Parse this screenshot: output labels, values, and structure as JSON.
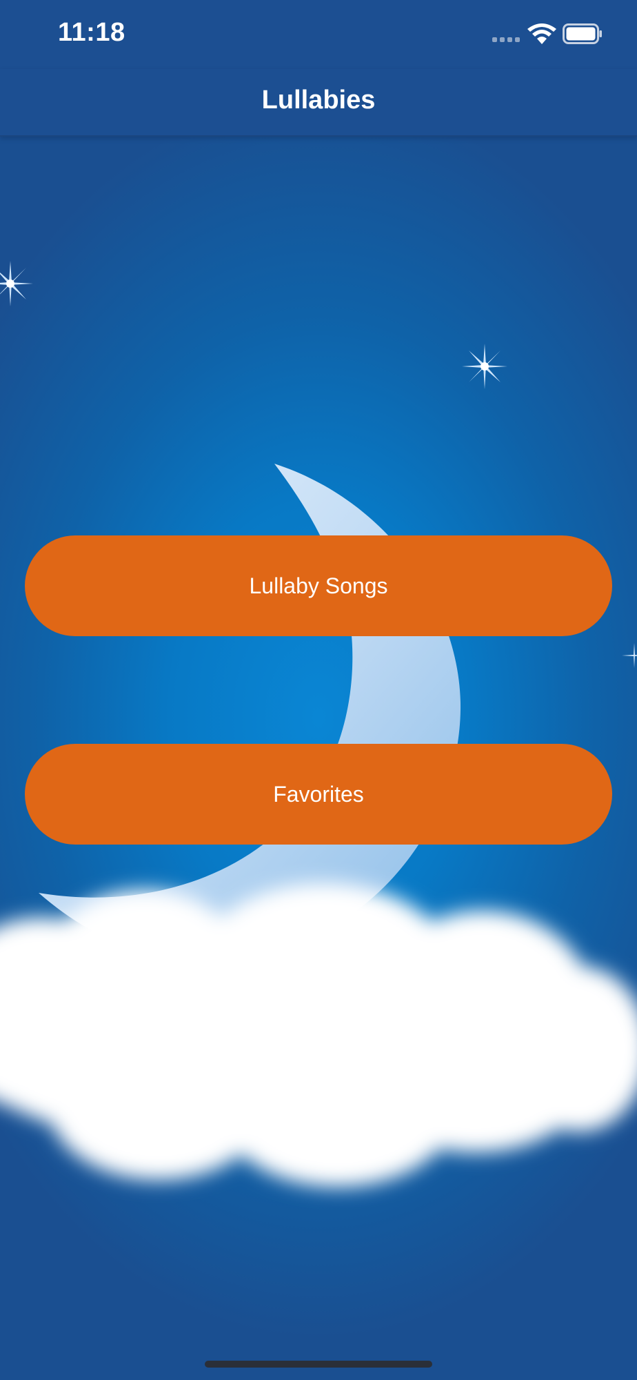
{
  "status_bar": {
    "time": "11:18",
    "icons": [
      "cellular-signal-icon",
      "wifi-icon",
      "battery-icon"
    ]
  },
  "nav": {
    "title": "Lullabies"
  },
  "buttons": {
    "lullaby_songs": "Lullaby Songs",
    "favorites": "Favorites"
  },
  "decorations": [
    "star-icon",
    "crescent-moon",
    "cloud"
  ],
  "colors": {
    "bar_background": "#1c4f92",
    "background_center": "#0a86d4",
    "background_edge": "#1a4f91",
    "button": "#e06716",
    "button_text": "#ffffff"
  }
}
